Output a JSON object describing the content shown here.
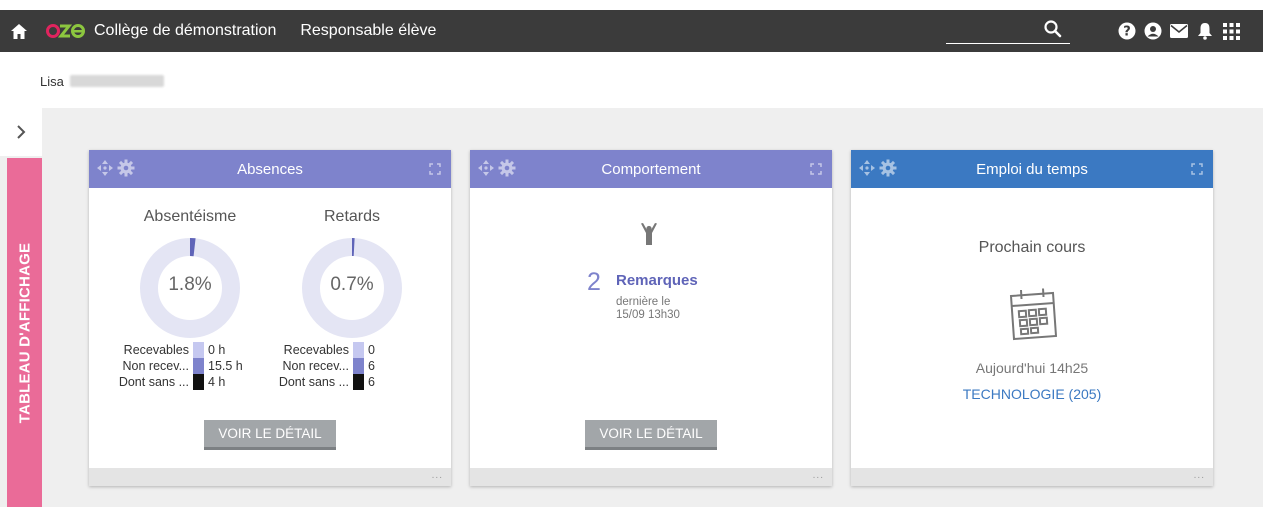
{
  "topbar": {
    "logo_text": "oze",
    "school": "Collège de démonstration",
    "role": "Responsable élève",
    "icons": [
      "home-icon",
      "search-icon",
      "help-icon",
      "user-icon",
      "mail-icon",
      "bell-icon",
      "apps-icon"
    ]
  },
  "user": {
    "first_name": "Lisa"
  },
  "sidebar": {
    "tab_label": "TABLEAU D'AFFICHAGE"
  },
  "widgets": {
    "absences": {
      "title": "Absences",
      "absenteeism": {
        "title": "Absentéisme",
        "value": "1.8%",
        "fraction": 0.018
      },
      "lateness": {
        "title": "Retards",
        "value": "0.7%",
        "fraction": 0.007
      },
      "legend_abs": [
        {
          "label": "Recevables",
          "value": "0 h",
          "color": "#c5c8f0"
        },
        {
          "label": "Non recev...",
          "value": "15.5 h",
          "color": "#7e83cc"
        },
        {
          "label": "Dont sans ...",
          "value": "4 h",
          "color": "#111111"
        }
      ],
      "legend_ret": [
        {
          "label": "Recevables",
          "value": "0",
          "color": "#c5c8f0"
        },
        {
          "label": "Non recev...",
          "value": "6",
          "color": "#7e83cc"
        },
        {
          "label": "Dont sans ...",
          "value": "6",
          "color": "#111111"
        }
      ],
      "button": "VOIR LE DÉTAIL",
      "footer": "..."
    },
    "behavior": {
      "title": "Comportement",
      "count": "2",
      "label": "Remarques",
      "date_line1": "dernière le",
      "date_line2": "15/09 13h30",
      "button": "VOIR LE DÉTAIL",
      "footer": "..."
    },
    "schedule": {
      "title": "Emploi du temps",
      "next_label": "Prochain cours",
      "time": "Aujourd'hui 14h25",
      "course": "TECHNOLOGIE (205)",
      "footer": "..."
    }
  },
  "colors": {
    "topbar": "#3b3b3b",
    "widget_header": "#7e83cc",
    "schedule_header": "#3b79c2",
    "side_tab": "#ea6b98",
    "button": "#a2a6a9"
  }
}
